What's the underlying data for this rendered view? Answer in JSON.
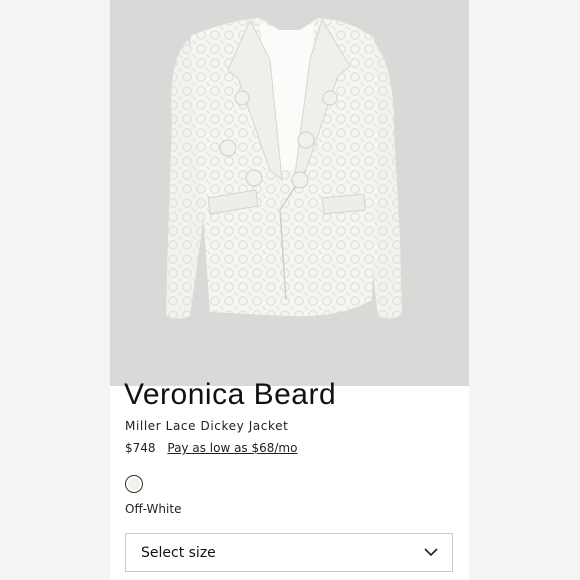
{
  "product": {
    "brand": "Veronica Beard",
    "name": "Miller Lace Dickey Jacket",
    "price": "$748",
    "installment_link": "Pay as low as $68/mo",
    "color_name": "Off-White",
    "size_select_label": "Select size"
  },
  "icons": {
    "product_image": "white-lace-blazer",
    "swatch": "off-white-swatch",
    "size_chevron": "chevron-down-icon"
  },
  "colors": {
    "background": "#ffffff",
    "side_panel": "#f4f4f3",
    "image_background": "#d9d9d8",
    "text": "#1a1a1a",
    "swatch": "#f3f1ec",
    "border": "#c9c9c9"
  }
}
